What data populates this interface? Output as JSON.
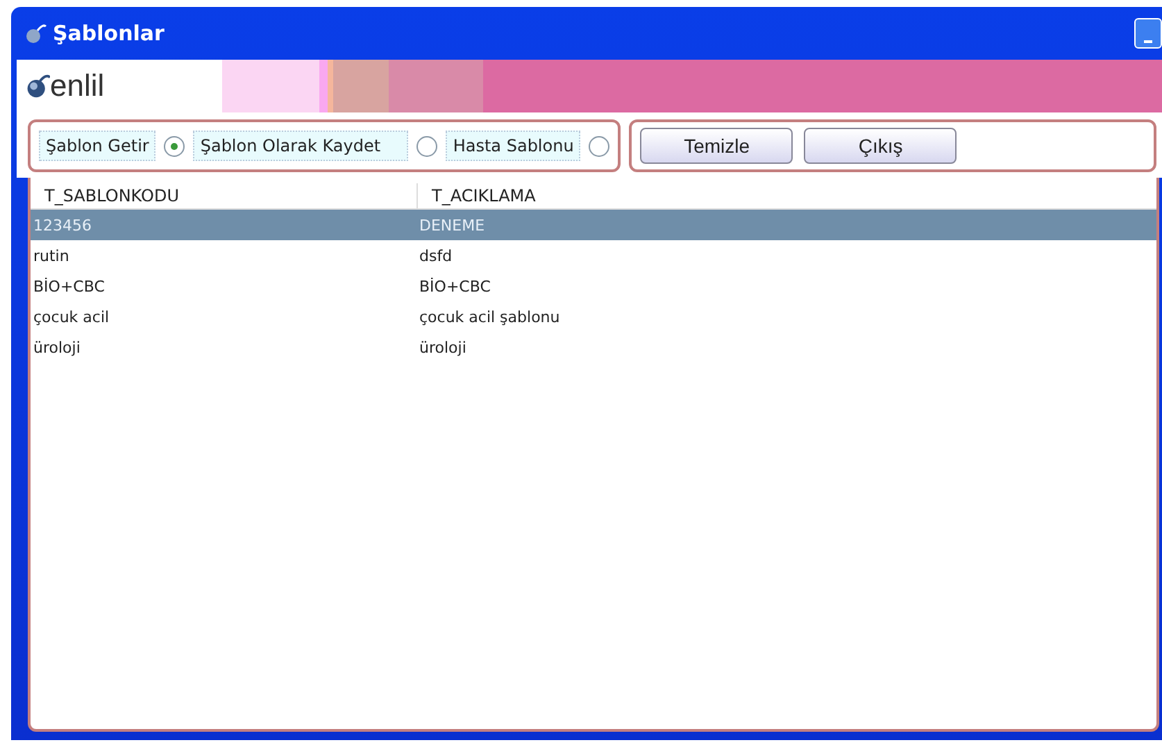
{
  "window": {
    "title": "Şablonlar"
  },
  "logo": {
    "text": "enlil"
  },
  "options": [
    {
      "label": "Şablon Getir",
      "selected": true
    },
    {
      "label": "Şablon Olarak Kaydet",
      "selected": false
    },
    {
      "label": "Hasta Sablonu",
      "selected": false
    }
  ],
  "buttons": [
    "Temizle",
    "Çıkış"
  ],
  "table": {
    "columns": [
      "T_SABLONKODU",
      "T_ACIKLAMA"
    ],
    "rows": [
      {
        "cells": [
          "123456",
          "DENEME"
        ],
        "selected": true
      },
      {
        "cells": [
          "rutin",
          "dsfd"
        ],
        "selected": false
      },
      {
        "cells": [
          "BİO+CBC",
          "BİO+CBC"
        ],
        "selected": false
      },
      {
        "cells": [
          "çocuk acil",
          "çocuk acil şablonu"
        ],
        "selected": false
      },
      {
        "cells": [
          "üroloji",
          "üroloji"
        ],
        "selected": false
      }
    ]
  }
}
